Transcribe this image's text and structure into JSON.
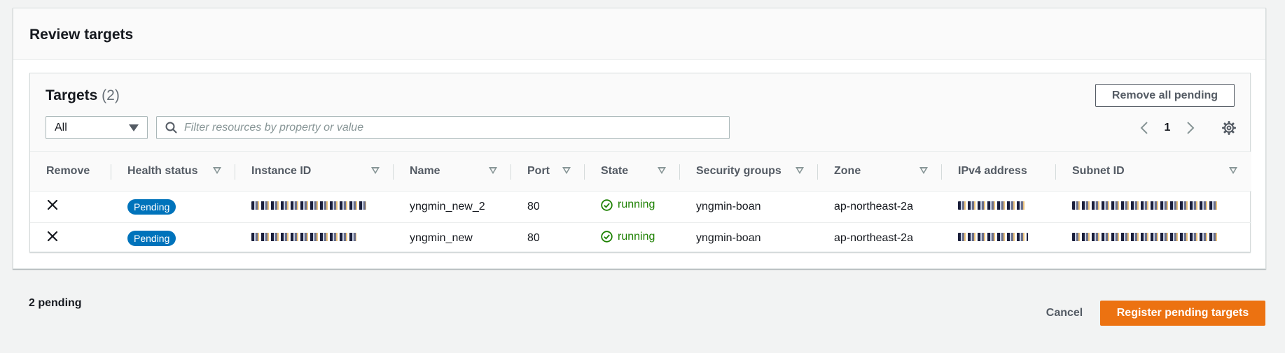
{
  "review": {
    "title": "Review targets"
  },
  "targets": {
    "title": "Targets",
    "count": "(2)",
    "remove_all_label": "Remove all pending",
    "filter_select_value": "All",
    "search_placeholder": "Filter resources by property or value",
    "page_number": "1",
    "columns": [
      "Remove",
      "Health status",
      "Instance ID",
      "Name",
      "Port",
      "State",
      "Security groups",
      "Zone",
      "IPv4 address",
      "Subnet ID"
    ],
    "rows": [
      {
        "health": "Pending",
        "name": "yngmin_new_2",
        "port": "80",
        "state": "running",
        "security_group": "yngmin-boan",
        "zone": "ap-northeast-2a"
      },
      {
        "health": "Pending",
        "name": "yngmin_new",
        "port": "80",
        "state": "running",
        "security_group": "yngmin-boan",
        "zone": "ap-northeast-2a"
      }
    ]
  },
  "footer": {
    "pending_text": "2 pending",
    "cancel_label": "Cancel",
    "register_label": "Register pending targets"
  },
  "colors": {
    "primary": "#ec7211",
    "badge": "#0073bb",
    "running": "#1d8102"
  },
  "icons": {
    "remove": "close-icon",
    "search": "search-icon",
    "prev": "chevron-left-icon",
    "next": "chevron-right-icon",
    "settings": "gear-icon",
    "running": "check-circle-icon",
    "sort": "sort-caret-icon"
  }
}
